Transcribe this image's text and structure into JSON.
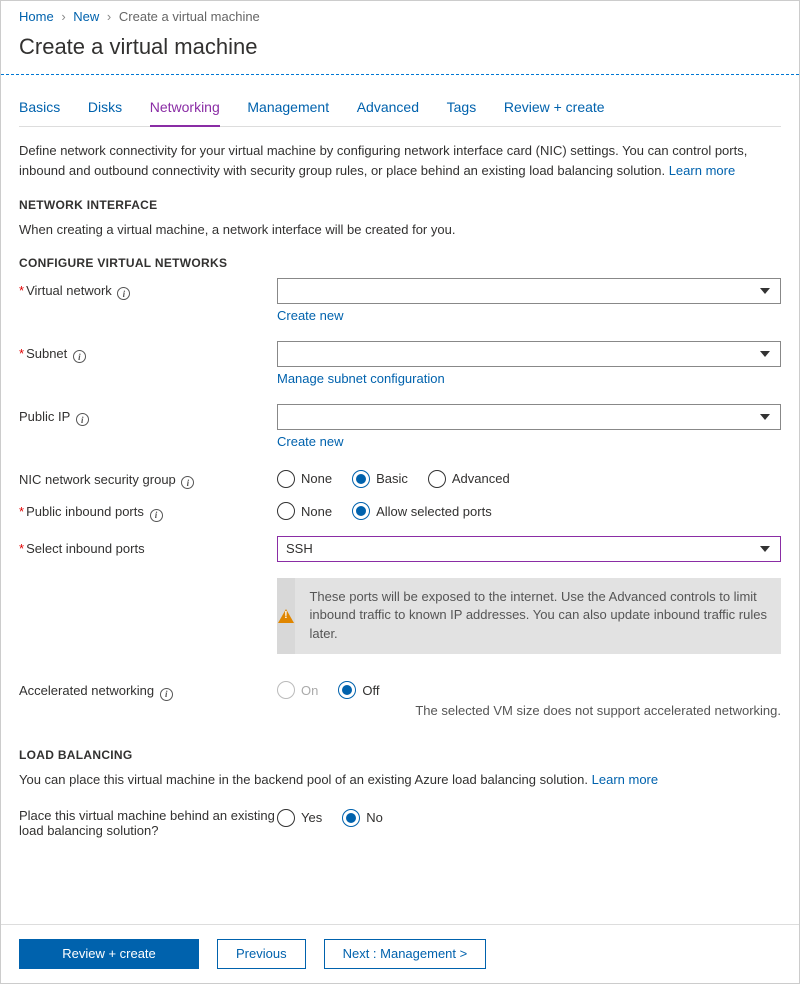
{
  "breadcrumb": {
    "home": "Home",
    "new": "New",
    "current": "Create a virtual machine"
  },
  "title": "Create a virtual machine",
  "tabs": {
    "basics": "Basics",
    "disks": "Disks",
    "networking": "Networking",
    "management": "Management",
    "advanced": "Advanced",
    "tags": "Tags",
    "review": "Review + create"
  },
  "intro": "Define network connectivity for your virtual machine by configuring network interface card (NIC) settings. You can control ports, inbound and outbound connectivity with security group rules, or place behind an existing load balancing solution.  ",
  "learn_more": "Learn more",
  "network_interface": {
    "heading": "NETWORK INTERFACE",
    "desc": "When creating a virtual machine, a network interface will be created for you."
  },
  "configure": {
    "heading": "CONFIGURE VIRTUAL NETWORKS",
    "virtual_network_label": "Virtual network",
    "virtual_network_value": "",
    "create_new": "Create new",
    "subnet_label": "Subnet",
    "subnet_value": "",
    "manage_subnet": "Manage subnet configuration",
    "public_ip_label": "Public IP",
    "public_ip_value": "",
    "nsg_label": "NIC network security group",
    "nsg_options": {
      "none": "None",
      "basic": "Basic",
      "advanced": "Advanced"
    },
    "inbound_label": "Public inbound ports",
    "inbound_options": {
      "none": "None",
      "allow": "Allow selected ports"
    },
    "select_ports_label": "Select inbound ports",
    "select_ports_value": "SSH",
    "warning": "These ports will be exposed to the internet. Use the Advanced controls to limit inbound traffic to known IP addresses. You can also update inbound traffic rules later.",
    "accel_label": "Accelerated networking",
    "accel_options": {
      "on": "On",
      "off": "Off"
    },
    "accel_note": "The selected VM size does not support accelerated networking."
  },
  "load_balancing": {
    "heading": "LOAD BALANCING",
    "desc": "You can place this virtual machine in the backend pool of an existing Azure load balancing solution.  ",
    "learn_more": "Learn more",
    "place_label": "Place this virtual machine behind an existing load balancing solution?",
    "options": {
      "yes": "Yes",
      "no": "No"
    }
  },
  "footer": {
    "review": "Review + create",
    "previous": "Previous",
    "next": "Next : Management >"
  }
}
